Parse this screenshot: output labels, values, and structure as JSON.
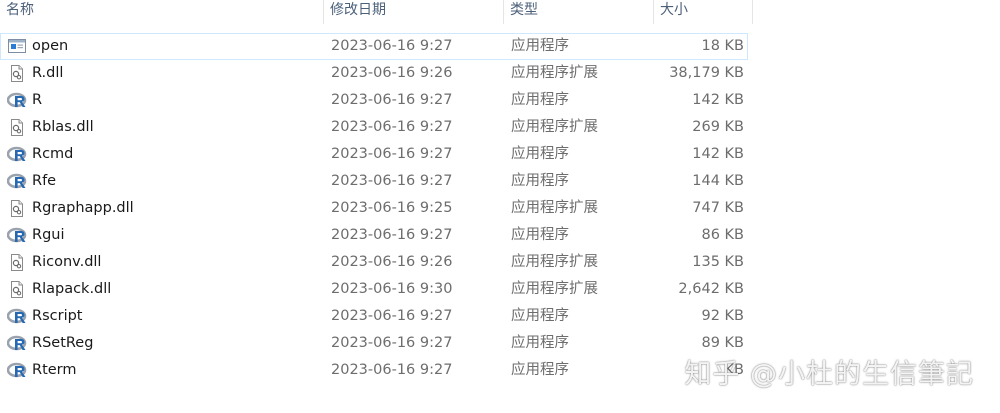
{
  "columns": {
    "name": "名称",
    "date": "修改日期",
    "type": "类型",
    "size": "大小"
  },
  "files": [
    {
      "name": "open",
      "date": "2023-06-16 9:27",
      "type": "应用程序",
      "size": "18 KB",
      "icon": "application-window-icon"
    },
    {
      "name": "R.dll",
      "date": "2023-06-16 9:26",
      "type": "应用程序扩展",
      "size": "38,179 KB",
      "icon": "dll-file-icon"
    },
    {
      "name": "R",
      "date": "2023-06-16 9:27",
      "type": "应用程序",
      "size": "142 KB",
      "icon": "r-logo-icon"
    },
    {
      "name": "Rblas.dll",
      "date": "2023-06-16 9:27",
      "type": "应用程序扩展",
      "size": "269 KB",
      "icon": "dll-file-icon"
    },
    {
      "name": "Rcmd",
      "date": "2023-06-16 9:27",
      "type": "应用程序",
      "size": "142 KB",
      "icon": "r-logo-icon"
    },
    {
      "name": "Rfe",
      "date": "2023-06-16 9:27",
      "type": "应用程序",
      "size": "144 KB",
      "icon": "r-logo-icon"
    },
    {
      "name": "Rgraphapp.dll",
      "date": "2023-06-16 9:25",
      "type": "应用程序扩展",
      "size": "747 KB",
      "icon": "dll-file-icon"
    },
    {
      "name": "Rgui",
      "date": "2023-06-16 9:27",
      "type": "应用程序",
      "size": "86 KB",
      "icon": "r-logo-icon"
    },
    {
      "name": "Riconv.dll",
      "date": "2023-06-16 9:26",
      "type": "应用程序扩展",
      "size": "135 KB",
      "icon": "dll-file-icon"
    },
    {
      "name": "Rlapack.dll",
      "date": "2023-06-16 9:30",
      "type": "应用程序扩展",
      "size": "2,642 KB",
      "icon": "dll-file-icon"
    },
    {
      "name": "Rscript",
      "date": "2023-06-16 9:27",
      "type": "应用程序",
      "size": "92 KB",
      "icon": "r-logo-icon"
    },
    {
      "name": "RSetReg",
      "date": "2023-06-16 9:27",
      "type": "应用程序",
      "size": "89 KB",
      "icon": "r-logo-icon"
    },
    {
      "name": "Rterm",
      "date": "2023-06-16 9:27",
      "type": "应用程序",
      "size": "KB",
      "icon": "r-logo-icon"
    }
  ],
  "selected_index": 0,
  "watermark": "知乎 @小杜的生信筆記"
}
